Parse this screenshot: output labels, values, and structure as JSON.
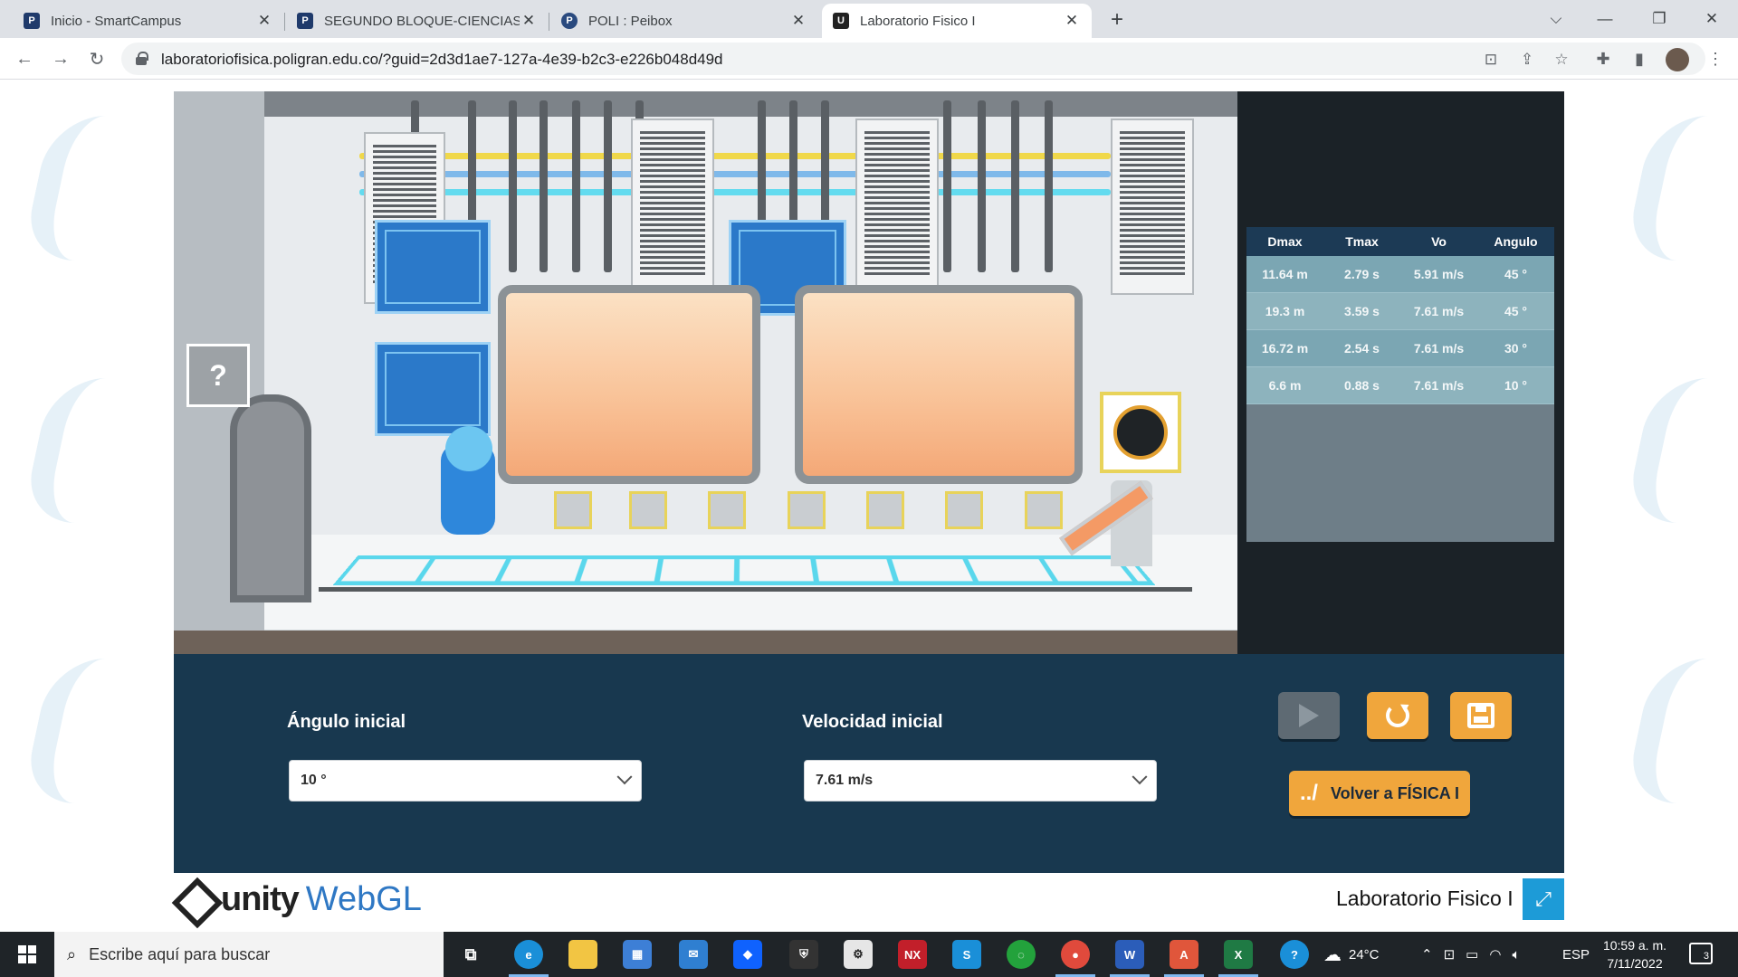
{
  "browser": {
    "tabs": [
      {
        "title": "Inicio - SmartCampus",
        "favicon": "P",
        "active": false
      },
      {
        "title": "SEGUNDO BLOQUE-CIENCIAS BA",
        "favicon": "P",
        "active": false
      },
      {
        "title": "POLI : Peibox",
        "favicon": "P",
        "active": false
      },
      {
        "title": "Laboratorio Fisico I",
        "favicon": "U",
        "active": true
      }
    ],
    "new_tab": "+",
    "url": "laboratoriofisica.poligran.edu.co/?guid=2d3d1ae7-127a-4e39-b2c3-e226b048d49d",
    "window_controls": {
      "dropdown": "⌵",
      "minimize": "—",
      "maximize": "❐",
      "close": "✕"
    }
  },
  "lab": {
    "help_icon": "?",
    "results": {
      "headers": [
        "Dmax",
        "Tmax",
        "Vo",
        "Angulo"
      ],
      "rows": [
        [
          "11.64 m",
          "2.79 s",
          "5.91 m/s",
          "45 °"
        ],
        [
          "19.3 m",
          "3.59 s",
          "7.61 m/s",
          "45 °"
        ],
        [
          "16.72 m",
          "2.54 s",
          "7.61 m/s",
          "30 °"
        ],
        [
          "6.6 m",
          "0.88 s",
          "7.61 m/s",
          "10 °"
        ]
      ]
    },
    "controls": {
      "angle_label": "Ángulo inicial",
      "angle_value": "10 °",
      "velocity_label": "Velocidad inicial",
      "velocity_value": "7.61 m/s",
      "back_glyph": "../",
      "back_label": "Volver a FÍSICA I"
    }
  },
  "footer": {
    "unity": "unity",
    "webgl": "WebGL",
    "title": "Laboratorio Fisico I",
    "fullscreen_icon": "⤢"
  },
  "taskbar": {
    "search_placeholder": "Escribe aquí para buscar",
    "weather": "24°C",
    "language": "ESP",
    "time": "10:59 a. m.",
    "date": "7/11/2022",
    "notifications": "3"
  },
  "colors": {
    "accent_orange": "#f0a63c",
    "panel_navy": "#18384f",
    "table_header": "#1c3a55",
    "webgl_blue": "#2f78c4"
  }
}
